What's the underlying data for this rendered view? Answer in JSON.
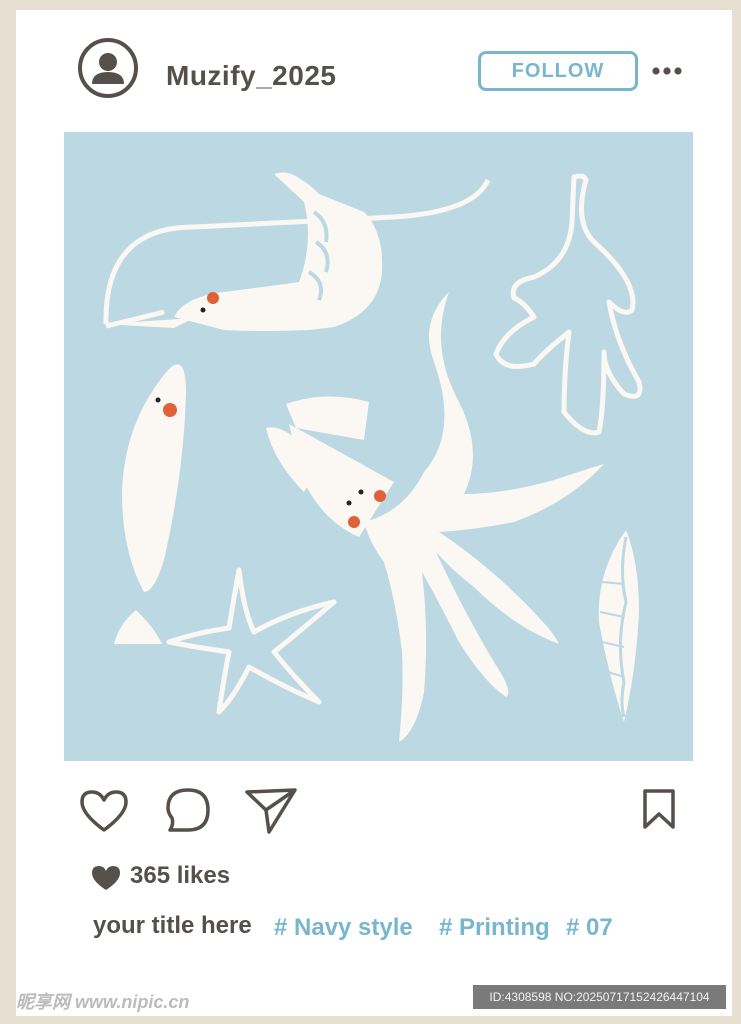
{
  "post": {
    "username": "Muzify_2025",
    "follow_label": "FOLLOW",
    "likes": "365 likes",
    "caption": "your title here",
    "hashtags": [
      "# Navy style",
      "# Printing",
      "# 07"
    ]
  },
  "icons": {
    "avatar": "user-avatar-icon",
    "more": "more-dots-icon",
    "like": "heart-outline-icon",
    "comment": "comment-bubble-icon",
    "share": "paper-plane-icon",
    "save": "bookmark-icon",
    "likes_heart": "heart-filled-icon"
  },
  "watermark": {
    "left": "昵享网 www.nipic.cn",
    "right": "ID:4308598 NO:20250717152426447104"
  },
  "colors": {
    "accent": "#78b6cd",
    "text": "#55504b",
    "image_bg": "#bcd9e3",
    "illustration": "#fbf7f3",
    "cheek": "#e0603a",
    "frame": "#e7dfd1"
  }
}
